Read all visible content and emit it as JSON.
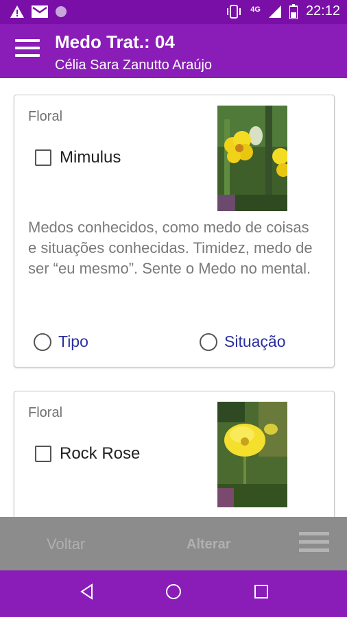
{
  "status_bar": {
    "time": "22:12",
    "network": "4G",
    "icons": [
      "warning-icon",
      "gmail-icon",
      "circle-icon",
      "vibrate-icon",
      "signal-icon",
      "battery-icon"
    ]
  },
  "app_bar": {
    "title": "Medo Trat.: 04",
    "subtitle": "Célia Sara Zanutto Araújo",
    "menu_icon": "hamburger-menu-icon"
  },
  "cards": [
    {
      "label": "Floral",
      "name": "Mimulus",
      "checked": false,
      "description": "Medos conhecidos, como medo de coisas e situações conhecidas. Timidez, medo de ser “eu mesmo”. Sente o Medo no mental.",
      "options": [
        "Tipo",
        "Situação"
      ]
    },
    {
      "label": "Floral",
      "name": "Rock Rose",
      "checked": false
    }
  ],
  "toolbar": {
    "back_label": "Voltar",
    "edit_label": "Alterar",
    "menu_icon": "menu-icon"
  },
  "colors": {
    "primary": "#8a1db8",
    "status_bar": "#7a0fa8",
    "toolbar": "#8c8c8c",
    "link": "#2b2ea0"
  }
}
